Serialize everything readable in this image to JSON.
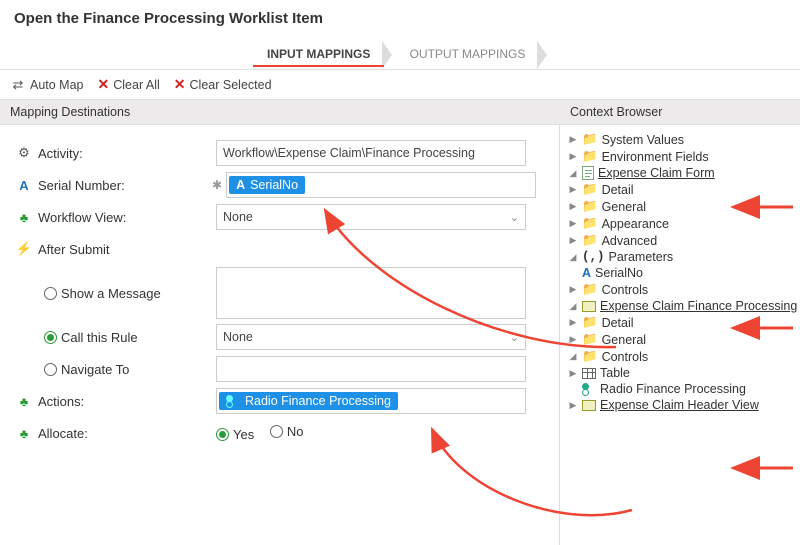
{
  "header": {
    "title": "Open the Finance Processing Worklist Item"
  },
  "tabs": {
    "input": "INPUT MAPPINGS",
    "output": "OUTPUT MAPPINGS"
  },
  "toolbar": {
    "automap": "Auto Map",
    "clearall": "Clear All",
    "clearsel": "Clear Selected"
  },
  "sections": {
    "left": "Mapping Destinations",
    "right": "Context Browser"
  },
  "dest": {
    "activity_lbl": "Activity:",
    "activity_val": "Workflow\\Expense Claim\\Finance Processing",
    "serial_lbl": "Serial Number:",
    "serial_chip": "SerialNo",
    "wfview_lbl": "Workflow View:",
    "wfview_val": "None",
    "after_lbl": "After Submit",
    "opt_msg": "Show a Message",
    "opt_rule": "Call this Rule",
    "opt_nav": "Navigate To",
    "rule_val": "None",
    "actions_lbl": "Actions:",
    "actions_chip": "Radio Finance Processing",
    "allocate_lbl": "Allocate:",
    "yes": "Yes",
    "no": "No"
  },
  "tree": {
    "sys": "System Values",
    "env": "Environment Fields",
    "form": "Expense Claim Form",
    "detail": "Detail",
    "general": "General",
    "appearance": "Appearance",
    "advanced": "Advanced",
    "params": "Parameters",
    "serial": "SerialNo",
    "controls": "Controls",
    "finview": "Expense Claim Finance Processing",
    "table": "Table",
    "radio": "Radio Finance Processing",
    "header": "Expense Claim Header View"
  }
}
